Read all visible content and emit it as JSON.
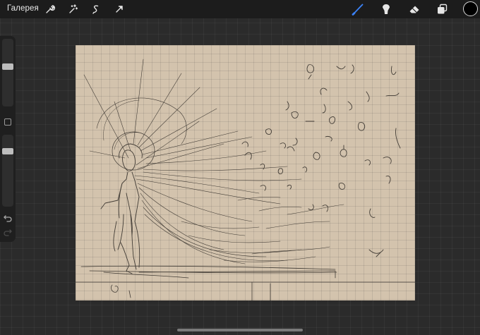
{
  "topbar": {
    "gallery_label": "Галерея",
    "left_tools": [
      {
        "icon": "wrench-icon",
        "name": "actions"
      },
      {
        "icon": "magic-wand-icon",
        "name": "adjustments"
      },
      {
        "icon": "selection-icon",
        "name": "selection"
      },
      {
        "icon": "transform-arrow-icon",
        "name": "transform"
      }
    ],
    "right_tools": [
      {
        "icon": "brush-icon",
        "name": "paint",
        "active": true
      },
      {
        "icon": "smudge-icon",
        "name": "smudge"
      },
      {
        "icon": "eraser-icon",
        "name": "erase"
      },
      {
        "icon": "layers-icon",
        "name": "layers"
      }
    ],
    "current_color": "#000000",
    "active_color": "#3b82f6"
  },
  "sidebar": {
    "brush_size_level": 0.15,
    "opacity_level": 0.2
  },
  "canvas": {
    "paper_color": "#d3c3ad",
    "stroke_color": "#2a2622"
  }
}
